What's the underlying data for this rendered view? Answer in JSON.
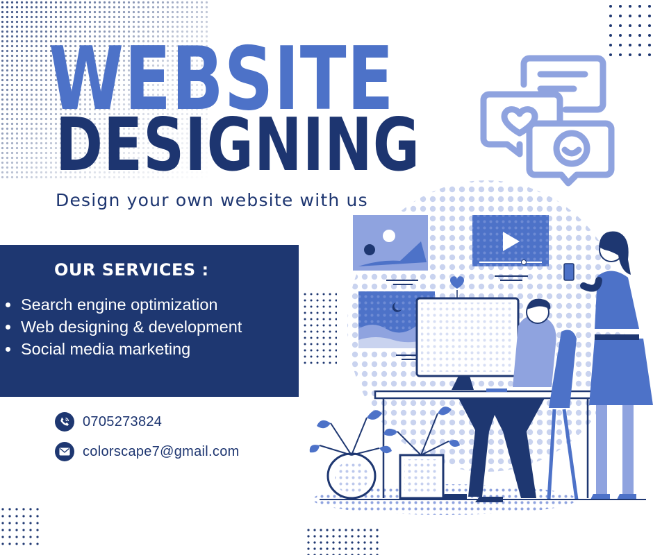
{
  "header": {
    "title_line1": "WEBSITE",
    "title_line2": "DESIGNING",
    "tagline": "Design your own website with us"
  },
  "services": {
    "heading": "OUR SERVICES :",
    "items": [
      "Search engine optimization",
      "Web designing & development",
      "Social media marketing"
    ]
  },
  "contact": {
    "phone": "0705273824",
    "phone_icon": "phone-icon",
    "email": "colorscape7@gmail.com",
    "email_icon": "mail-icon"
  },
  "colors": {
    "navy": "#1e3771",
    "blue": "#4d72c8",
    "light_blue": "#8fa3df",
    "background": "#ffffff"
  }
}
